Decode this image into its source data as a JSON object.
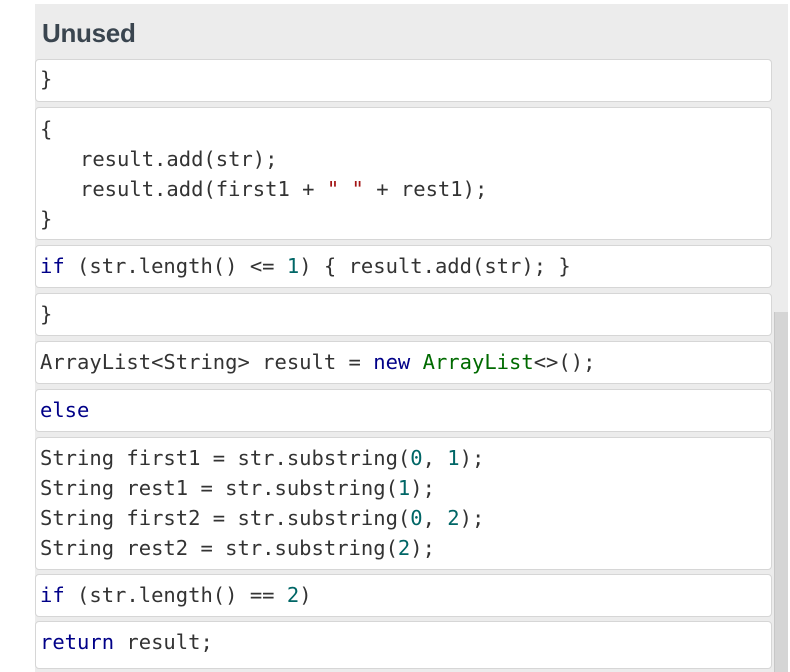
{
  "panel": {
    "title": "Unused"
  },
  "blocks": [
    {
      "lines": [
        "}"
      ]
    },
    {
      "lines": [
        "{",
        "result.add(str);",
        "result.add(first1 + ",
        "\" \"",
        " + rest1);",
        "}"
      ]
    },
    {
      "lines": [
        "if",
        " (str.length() <= ",
        "1",
        ") { result.add(str); }"
      ]
    },
    {
      "lines": [
        "}"
      ]
    },
    {
      "lines": [
        "ArrayList<String> result = ",
        "new",
        " ",
        "ArrayList",
        "<>();"
      ]
    },
    {
      "lines": [
        "else"
      ]
    },
    {
      "lines": [
        "String first1 = str.substring(",
        "0",
        ", ",
        "1",
        ");",
        "String rest1 = str.substring(",
        "1",
        ");",
        "String first2 = str.substring(",
        "0",
        ", ",
        "2",
        ");",
        "String rest2 = str.substring(",
        "2",
        ");"
      ]
    },
    {
      "lines": [
        "if",
        " (str.length() == ",
        "2",
        ")"
      ]
    },
    {
      "lines": [
        "return",
        " result;"
      ]
    }
  ],
  "colors": {
    "keyword": "#000088",
    "class": "#006a00",
    "number": "#006666",
    "string": "#a31515",
    "title": "#3a454f",
    "panel_bg": "#ececec"
  }
}
